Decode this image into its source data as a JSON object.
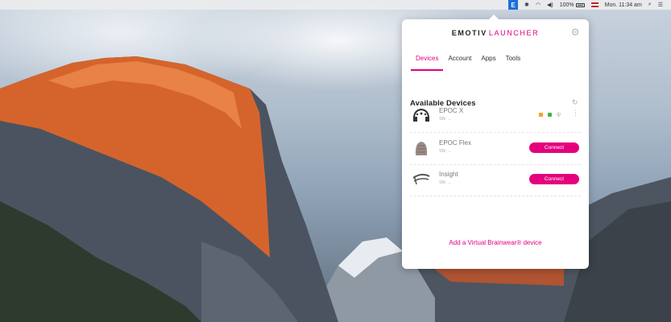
{
  "menubar": {
    "tray_glyph": "E",
    "battery_text": "100%",
    "time": "Mon. 11:34 am",
    "icons": [
      "emotiv-tray-icon",
      "bluetooth-icon",
      "wifi-icon",
      "volume-icon",
      "battery-icon",
      "flag-icon",
      "search-icon",
      "list-icon"
    ]
  },
  "panel": {
    "brand_part1": "EMOTIV",
    "brand_part2": "LAUNCHER",
    "tabs": [
      {
        "label": "Devices",
        "active": true
      },
      {
        "label": "Account",
        "active": false
      },
      {
        "label": "Apps",
        "active": false
      },
      {
        "label": "Tools",
        "active": false
      }
    ],
    "section_title": "Available Devices",
    "devices": [
      {
        "name": "EPOC X",
        "serial": "SN: ...",
        "connected": true
      },
      {
        "name": "EPOC Flex",
        "serial": "SN: ...",
        "connect_label": "Connect"
      },
      {
        "name": "Insight",
        "serial": "SN: ...",
        "connect_label": "Connect"
      }
    ],
    "virtual_link": "Add a Virtual Brainwear® device"
  },
  "colors": {
    "accent": "#e4007d",
    "status_orange": "#f2a51e",
    "status_green": "#44b04a"
  }
}
